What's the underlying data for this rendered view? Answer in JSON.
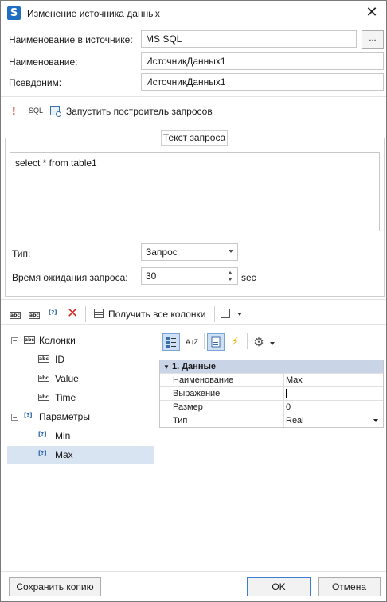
{
  "window": {
    "title": "Изменение источника данных",
    "app_icon_letter": "S",
    "close_glyph": "✕"
  },
  "form": {
    "source_name_label": "Наименование в источнике:",
    "source_name_value": "MS SQL",
    "browse_label": "...",
    "name_label": "Наименование:",
    "name_value": "ИсточникДанных1",
    "alias_label": "Псевдоним:",
    "alias_value": "ИсточникДанных1"
  },
  "query_toolbar": {
    "warning_glyph": "!",
    "sql_label": "SQL",
    "builder_label": "Запустить построитель запросов"
  },
  "query": {
    "group_caption": "Текст запроса",
    "text": "select * from table1",
    "type_label": "Тип:",
    "type_value": "Запрос",
    "timeout_label": "Время ожидания запроса:",
    "timeout_value": "30",
    "timeout_unit": "sec"
  },
  "columns_toolbar": {
    "abc_glyph": "abc",
    "param_glyph": "[?]",
    "delete_glyph": "✕",
    "get_all_label": "Получить все колонки"
  },
  "tree": {
    "columns_label": "Колонки",
    "columns": [
      "ID",
      "Value",
      "Time"
    ],
    "params_label": "Параметры",
    "params": [
      "Min",
      "Max"
    ],
    "selected": "Max",
    "expander_glyph": "−"
  },
  "properties": {
    "sort_az_glyph": "A↓Z",
    "lightning_glyph": "⚡",
    "gear_glyph": "⚙",
    "category": "1. Данные",
    "rows": [
      {
        "name": "Наименование",
        "value": "Max"
      },
      {
        "name": "Выражение",
        "value": ""
      },
      {
        "name": "Размер",
        "value": "0"
      },
      {
        "name": "Тип",
        "value": "Real"
      }
    ]
  },
  "footer": {
    "save_copy": "Сохранить копию",
    "ok": "OK",
    "cancel": "Отмена"
  },
  "colors": {
    "accent": "#3c7fd1",
    "selection": "#d9e4f3",
    "category_bg": "#c9d5e6",
    "warning": "#d42b2b"
  }
}
